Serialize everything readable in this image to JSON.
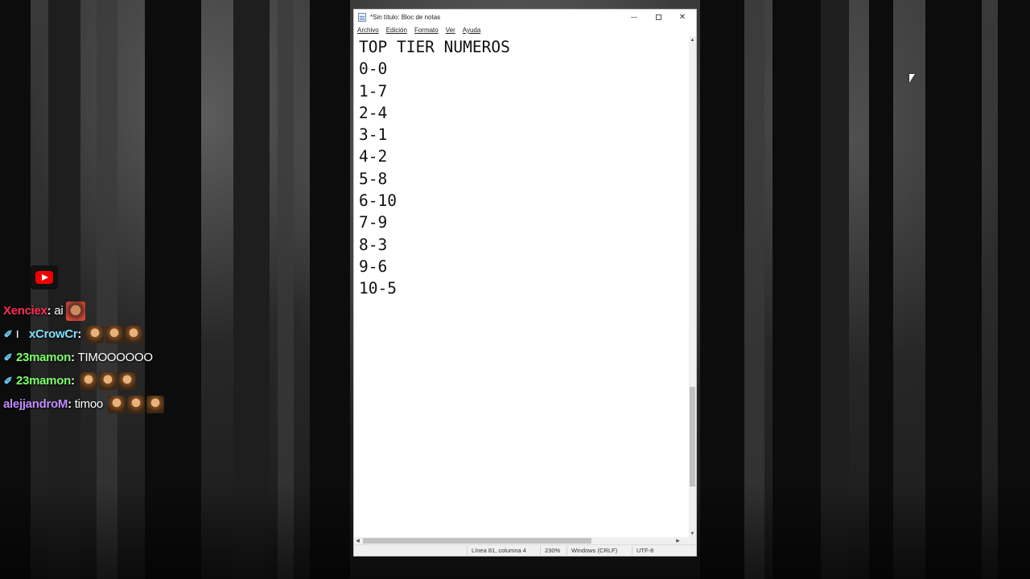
{
  "window": {
    "title": "*Sin título: Bloc de notas",
    "controls": {
      "minimize": "minimize",
      "maximize": "maximize",
      "close": "✕"
    }
  },
  "menu": [
    "Archivo",
    "Edición",
    "Formato",
    "Ver",
    "Ayuda"
  ],
  "document": {
    "lines": [
      "TOP TIER NUMEROS",
      "0-0",
      "1-7",
      "2-4",
      "3-1",
      "4-2",
      "5-8",
      "6-10",
      "7-9",
      "8-3",
      "9-6",
      "10-5"
    ]
  },
  "statusbar": {
    "position": "Línea 81, columna 4",
    "zoom": "230%",
    "line_ending": "Windows (CRLF)",
    "encoding": "UTF-8"
  },
  "chat": {
    "platform_icon": "youtube-icon",
    "messages": [
      {
        "user": "Xenciex",
        "color": "#ff2d55",
        "text": "ai",
        "badges": [],
        "emotes": 1
      },
      {
        "user": "xCrowCr",
        "color": "#7fe0ff",
        "text": "",
        "badges": [
          "sword",
          "bar"
        ],
        "emotes": 3
      },
      {
        "user": "23mamon",
        "color": "#7dff6a",
        "text": "TIMOOOOOO",
        "badges": [
          "sword"
        ],
        "emotes": 0
      },
      {
        "user": "23mamon",
        "color": "#7dff6a",
        "text": "",
        "badges": [
          "sword"
        ],
        "emotes": 3
      },
      {
        "user": "alejjandroM",
        "color": "#c08bff",
        "text": "timoo",
        "badges": [],
        "emotes": 3
      }
    ]
  }
}
